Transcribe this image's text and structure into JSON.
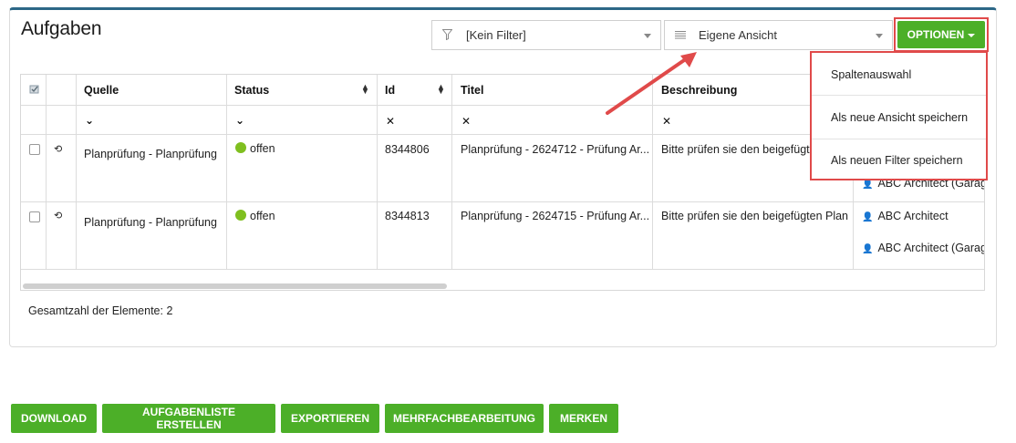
{
  "page": {
    "title": "Aufgaben"
  },
  "toolbar": {
    "filter_value": "[Kein Filter]",
    "view_value": "Eigene Ansicht",
    "options_label": "OPTIONEN"
  },
  "options_menu": {
    "items": [
      {
        "label": "Spaltenauswahl"
      },
      {
        "label": "Als neue Ansicht speichern"
      },
      {
        "label": "Als neuen Filter speichern"
      }
    ]
  },
  "table": {
    "columns": [
      {
        "key": "quelle",
        "label": "Quelle"
      },
      {
        "key": "status",
        "label": "Status"
      },
      {
        "key": "id",
        "label": "Id"
      },
      {
        "key": "titel",
        "label": "Titel"
      },
      {
        "key": "beschreibung",
        "label": "Beschreibung"
      }
    ],
    "rows": [
      {
        "quelle": "Planprüfung - Planprüfung",
        "status": "offen",
        "id": "8344806",
        "titel": "Planprüfung - 2624712 - Prüfung Ar...",
        "beschreibung": "Bitte prüfen sie den beigefügten",
        "assignees": [
          "ABC Architect (Garage"
        ]
      },
      {
        "quelle": "Planprüfung - Planprüfung",
        "status": "offen",
        "id": "8344813",
        "titel": "Planprüfung - 2624715 - Prüfung Ar...",
        "beschreibung": "Bitte prüfen sie den beigefügten Plan",
        "assignees": [
          "ABC Architect",
          "ABC Architect (Garage"
        ]
      }
    ],
    "status_color": "#7fbf1f"
  },
  "footer": {
    "total": "Gesamtzahl der Elemente: 2"
  },
  "actions": [
    {
      "label": "DOWNLOAD"
    },
    {
      "label": "AUFGABENLISTE ERSTELLEN"
    },
    {
      "label": "EXPORTIEREN"
    },
    {
      "label": "MEHRFACHBEARBEITUNG"
    },
    {
      "label": "MERKEN"
    }
  ],
  "colors": {
    "accent": "#4caf28",
    "highlight": "#e04a4a",
    "header_bar": "#2c6787"
  }
}
